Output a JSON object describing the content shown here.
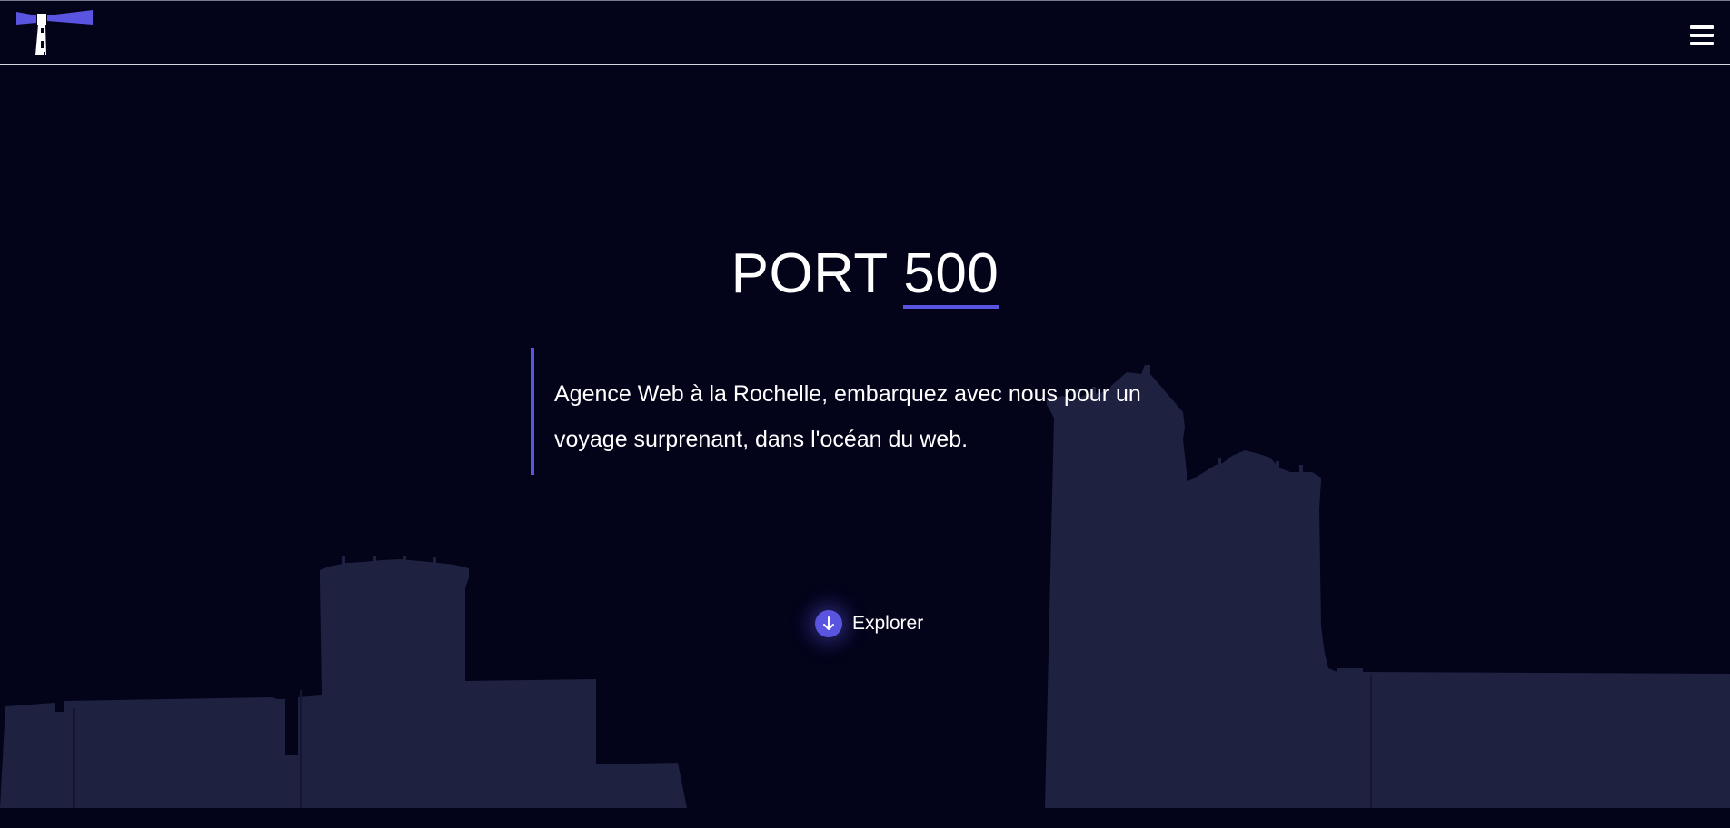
{
  "header": {
    "logo_label": "Port 500",
    "menu_icon": "hamburger-menu-icon"
  },
  "hero": {
    "title_word": "PORT",
    "title_number": "500",
    "tagline": "Agence Web à la Rochelle, embarquez avec nous pour un voyage surprenant, dans l'océan du web.",
    "explore_label": "Explorer",
    "explore_icon": "arrow-down-icon"
  },
  "colors": {
    "background": "#03031a",
    "accent": "#5a55e0",
    "silhouette": "#1e1f3d",
    "text": "#ffffff"
  }
}
